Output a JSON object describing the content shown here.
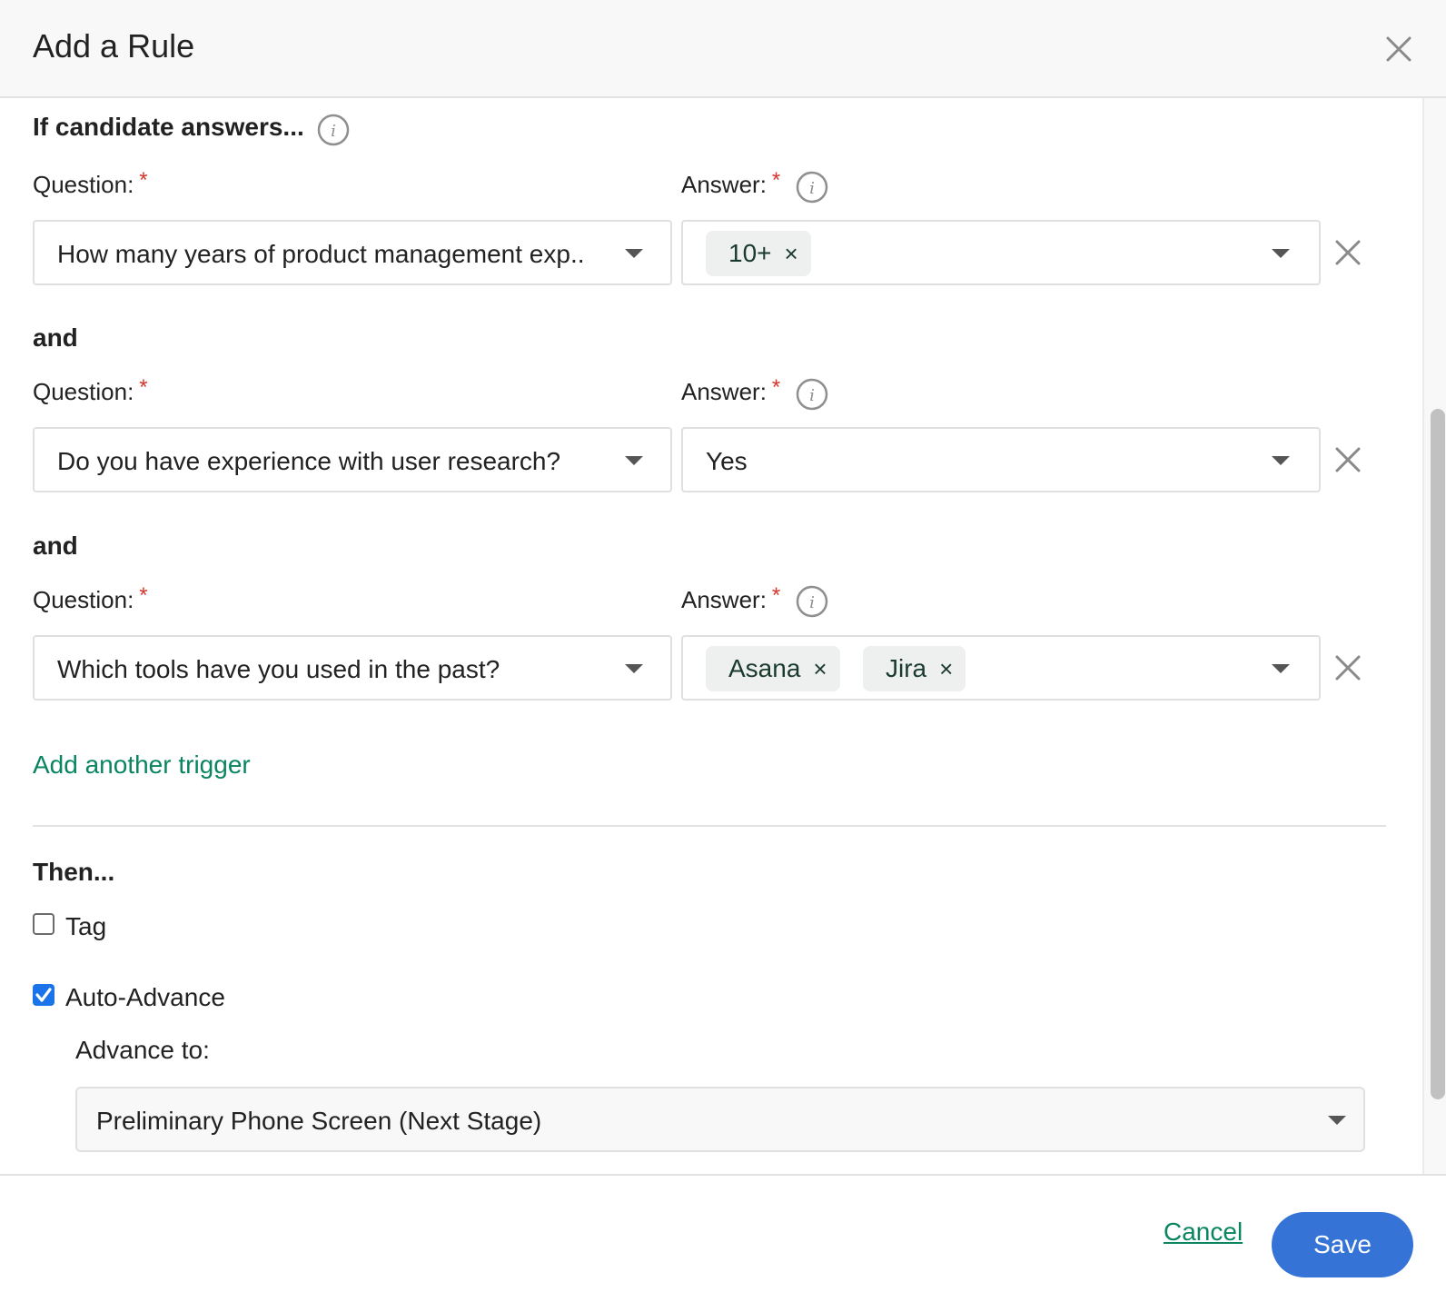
{
  "dialog": {
    "title": "Add a Rule",
    "close_icon": "close-icon"
  },
  "trigger_section": {
    "title": "If candidate answers...",
    "connector": "and",
    "add_trigger_label": "Add another trigger",
    "rows": [
      {
        "question_label": "Question:",
        "answer_label": "Answer:",
        "required_mark": "*",
        "question_value": "How many years of product management exp..",
        "answer_value": "",
        "answer_chips": [
          "10+"
        ]
      },
      {
        "question_label": "Question:",
        "answer_label": "Answer:",
        "required_mark": "*",
        "question_value": "Do you have experience with user research?",
        "answer_value": "Yes",
        "answer_chips": []
      },
      {
        "question_label": "Question:",
        "answer_label": "Answer:",
        "required_mark": "*",
        "question_value": "Which tools have you used in the past?",
        "answer_value": "",
        "answer_chips": [
          "Asana",
          "Jira"
        ]
      }
    ]
  },
  "action_section": {
    "title": "Then...",
    "tag": {
      "label": "Tag",
      "checked": false
    },
    "auto_advance": {
      "label": "Auto-Advance",
      "checked": true
    },
    "advance_to_label": "Advance to:",
    "advance_to_value": "Preliminary Phone Screen (Next Stage)"
  },
  "footer": {
    "cancel_label": "Cancel",
    "save_label": "Save"
  },
  "chip_remove_glyph": "×",
  "colors": {
    "accent_green": "#0a8561",
    "primary_blue": "#3574d6",
    "required_red": "#d9342b",
    "checkbox_blue": "#1a73e8"
  }
}
